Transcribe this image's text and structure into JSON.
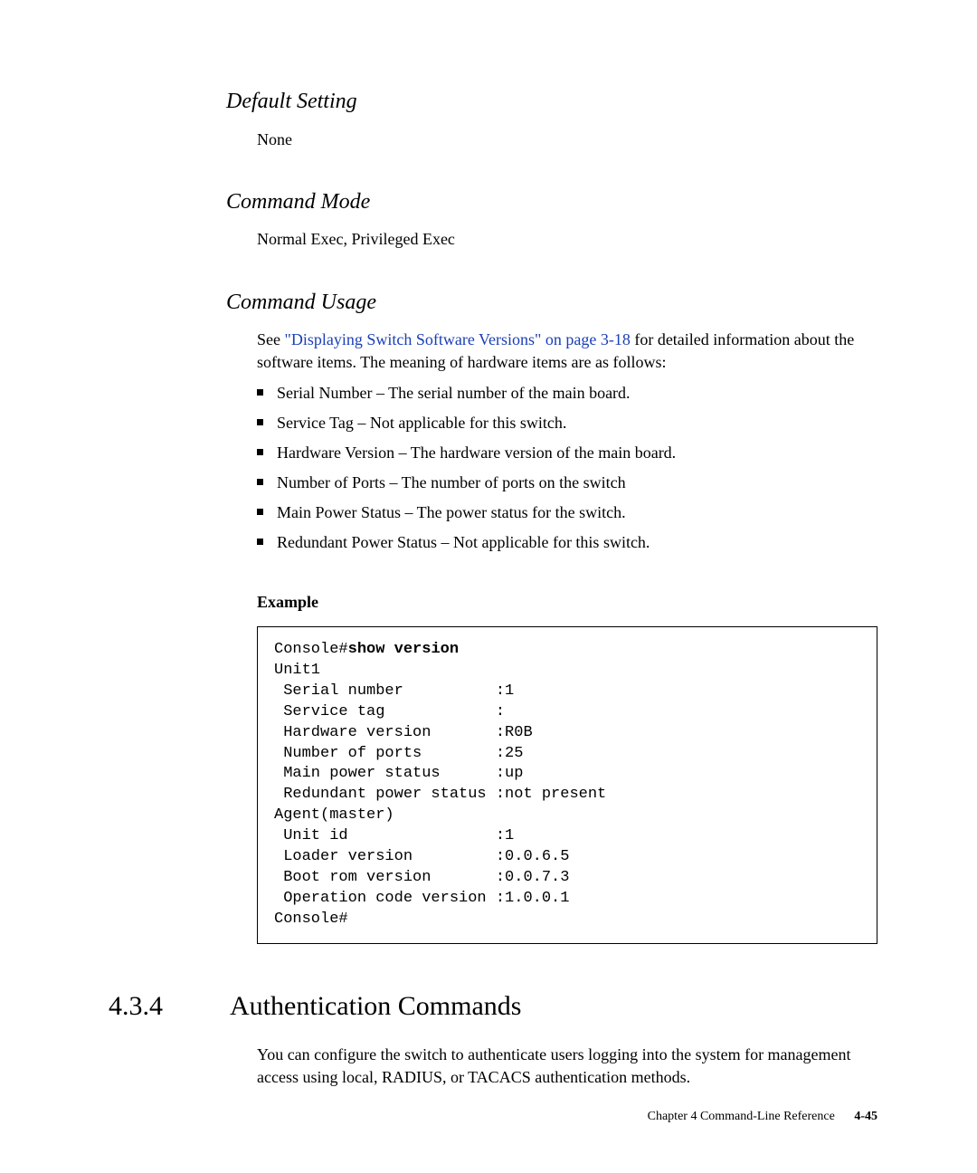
{
  "headings": {
    "default_setting": "Default Setting",
    "command_mode": "Command Mode",
    "command_usage": "Command Usage"
  },
  "default_setting_text": "None",
  "command_mode_text": "Normal Exec, Privileged Exec",
  "usage_intro_pre": "See ",
  "usage_intro_link": "\"Displaying Switch Software Versions\" on page 3-18",
  "usage_intro_post": " for detailed information about the software items. The meaning of hardware items are as follows:",
  "bullets": [
    "Serial Number – The serial number of the main board.",
    "Service Tag – Not applicable for this switch.",
    "Hardware Version – The hardware version of the main board.",
    "Number of Ports – The number of ports on the switch",
    "Main Power Status – The power status for the switch.",
    "Redundant Power Status – Not applicable for this switch."
  ],
  "example_label": "Example",
  "code_prompt": "Console#",
  "code_cmd": "show version",
  "code_body": "Unit1\n Serial number          :1\n Service tag            :\n Hardware version       :R0B\n Number of ports        :25\n Main power status      :up\n Redundant power status :not present\nAgent(master)\n Unit id                :1\n Loader version         :0.0.6.5\n Boot rom version       :0.0.7.3\n Operation code version :1.0.0.1\nConsole#",
  "section_number": "4.3.4",
  "section_title": "Authentication Commands",
  "section_body": "You can configure the switch to authenticate users logging into the system for management access using local, RADIUS, or TACACS authentication methods.",
  "footer_chapter": "Chapter 4   Command-Line Reference",
  "footer_page": "4-45"
}
